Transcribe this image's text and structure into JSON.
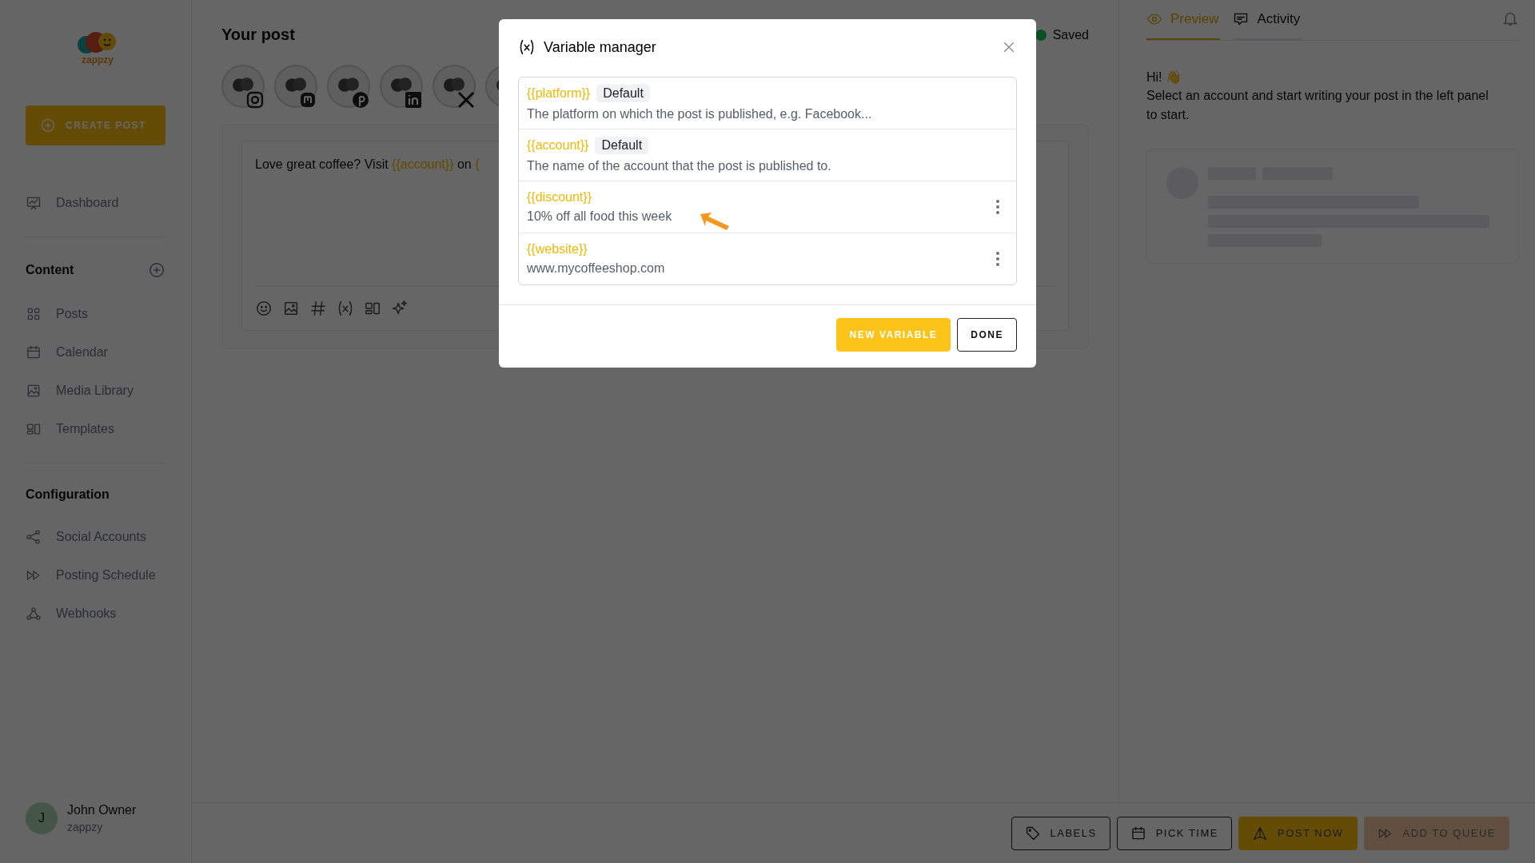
{
  "sidebar": {
    "logo_text": "zappzy",
    "create_button": "CREATE POST",
    "top_items": [
      {
        "label": "Dashboard",
        "kind": "dashboard"
      }
    ],
    "sections": [
      {
        "title": "Content",
        "add_button": true,
        "items": [
          {
            "label": "Posts",
            "kind": "grid"
          },
          {
            "label": "Calendar",
            "kind": "calendar"
          },
          {
            "label": "Media Library",
            "kind": "image"
          },
          {
            "label": "Templates",
            "kind": "template"
          }
        ]
      },
      {
        "title": "Configuration",
        "add_button": false,
        "items": [
          {
            "label": "Social Accounts",
            "kind": "share"
          },
          {
            "label": "Posting Schedule",
            "kind": "forward"
          },
          {
            "label": "Webhooks",
            "kind": "webhook"
          }
        ]
      }
    ],
    "user": {
      "initial": "J",
      "name": "John Owner",
      "org": "zappzy"
    }
  },
  "editor": {
    "title": "Your post",
    "status": "Saved",
    "accounts": [
      {
        "kind": "instagram"
      },
      {
        "kind": "mastodon"
      },
      {
        "kind": "pinterest"
      },
      {
        "kind": "linkedin"
      },
      {
        "kind": "x"
      },
      {
        "kind": "none"
      }
    ],
    "text": [
      {
        "kind": "text",
        "value": "Love great coffee? Visit "
      },
      {
        "kind": "variable",
        "value": "{{account}}"
      },
      {
        "kind": "text",
        "value": " on "
      },
      {
        "kind": "variable",
        "value": "{"
      }
    ],
    "toolbar": [
      {
        "kind": "emoji"
      },
      {
        "kind": "image"
      },
      {
        "kind": "hashtag"
      },
      {
        "kind": "variable"
      },
      {
        "kind": "template"
      },
      {
        "kind": "sparkles"
      }
    ]
  },
  "preview": {
    "tabs": [
      {
        "label": "Preview",
        "kind": "eye",
        "selected": true
      },
      {
        "label": "Activity",
        "kind": "chat",
        "selected": false
      }
    ],
    "greeting": "Hi! 👋",
    "message": "Select an account and start writing your post in the left panel to start."
  },
  "actions": [
    {
      "label": "LABELS",
      "kind": "tag",
      "disabled": false
    },
    {
      "label": "PICK TIME",
      "kind": "calendar",
      "disabled": false
    },
    {
      "label": "POST NOW",
      "kind": "send",
      "disabled": false
    },
    {
      "label": "ADD TO QUEUE",
      "kind": "forward",
      "disabled": true
    }
  ],
  "modal": {
    "title": "Variable manager",
    "variables": [
      {
        "name": "{{platform}}",
        "badge": "Default",
        "description": "The platform on which the post is published, e.g. Facebook...",
        "menu": false
      },
      {
        "name": "{{account}}",
        "badge": "Default",
        "description": "The name of the account that the post is published to.",
        "menu": false
      },
      {
        "name": "{{discount}}",
        "description": "10% off all food this week",
        "menu": true
      },
      {
        "name": "{{website}}",
        "description": "www.mycoffeeshop.com",
        "menu": true
      }
    ],
    "buttons": [
      {
        "label": "NEW VARIABLE"
      },
      {
        "label": "DONE"
      }
    ]
  }
}
